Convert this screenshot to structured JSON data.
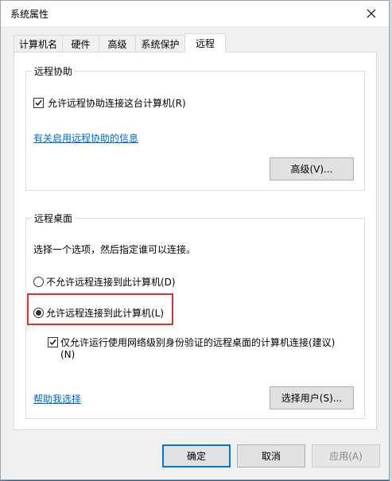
{
  "window": {
    "title": "系统属性"
  },
  "tabs": [
    {
      "label": "计算机名"
    },
    {
      "label": "硬件"
    },
    {
      "label": "高级"
    },
    {
      "label": "系统保护"
    },
    {
      "label": "远程"
    }
  ],
  "remote_assistance": {
    "group_title": "远程协助",
    "allow_label": "允许远程协助连接这台计算机(R)",
    "allow_checked": true,
    "info_link": "有关启用远程协助的信息",
    "advanced_button": "高级(V)..."
  },
  "remote_desktop": {
    "group_title": "远程桌面",
    "instruction": "选择一个选项，然后指定谁可以连接。",
    "option_disallow": "不允许远程连接到此计算机(D)",
    "option_allow": "允许远程连接到此计算机(L)",
    "selected_option": "allow",
    "nla_label_line1": "仅允许运行使用网络级别身份验证的远程桌面的计算机连接(建议)",
    "nla_label_line2": "(N)",
    "nla_checked": true,
    "help_link": "帮助我选择",
    "select_users_button": "选择用户(S)..."
  },
  "footer": {
    "ok_button": "确定",
    "cancel_button": "取消",
    "apply_button": "应用(A)"
  },
  "icons": {
    "close": "close-icon",
    "checkmark": "checkmark-icon",
    "radio_dot": "radio-selected-icon"
  },
  "colors": {
    "link": "#0066cc",
    "highlight": "#e03030",
    "default_button_border": "#0078d7"
  }
}
